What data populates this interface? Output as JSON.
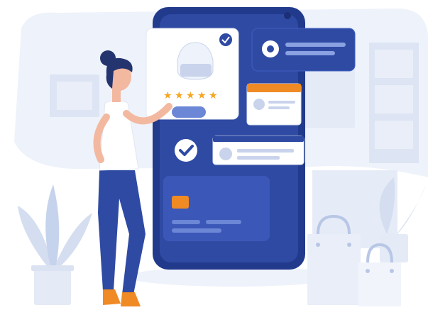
{
  "illustration": {
    "rating": {
      "stars": 5,
      "filled": 5
    },
    "colors": {
      "primary": "#2f4aa3",
      "primary_dark": "#233b8c",
      "accent_orange": "#f08a24",
      "star": "#f5a623",
      "light_blue": "#e6ecf8",
      "card_white": "#ffffff"
    },
    "icons": [
      "gear-icon",
      "check-icon",
      "shopping-bag-icon",
      "credit-card-icon",
      "star-icon",
      "plant-icon"
    ]
  }
}
